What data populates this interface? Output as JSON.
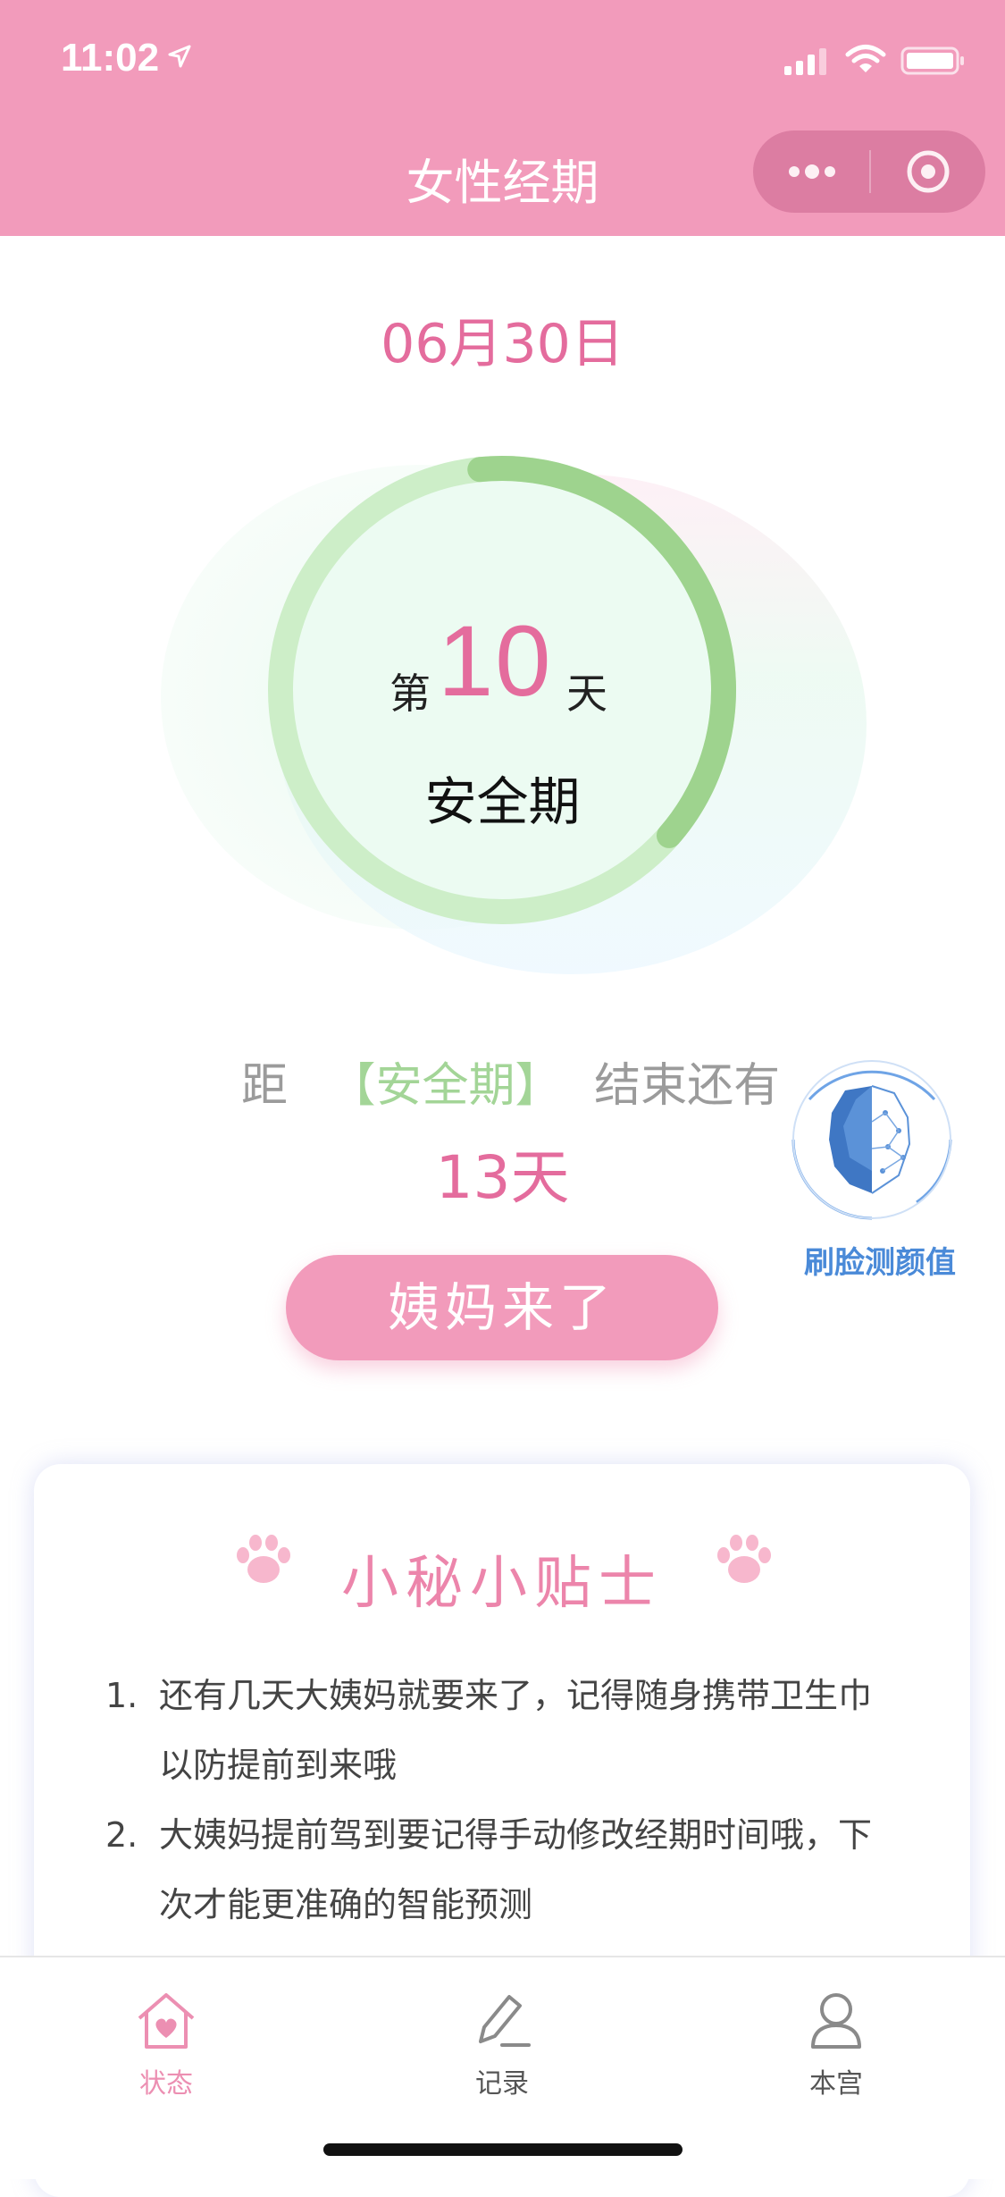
{
  "status_bar": {
    "time": "11:02"
  },
  "nav": {
    "title": "女性经期"
  },
  "date": "06月30日",
  "cycle": {
    "day_prefix": "第",
    "day_number": "10",
    "day_suffix": "天",
    "phase": "安全期",
    "progress_fraction": 0.38
  },
  "countdown": {
    "prefix": "距",
    "phase_tag": "【安全期】",
    "suffix": "结束还有",
    "days": "13天"
  },
  "face_widget": {
    "label": "刷脸测颜值"
  },
  "period_button": {
    "label": "姨妈来了"
  },
  "tips": {
    "title": "小秘小贴士",
    "items": [
      {
        "num": "1.",
        "text": "还有几天大姨妈就要来了，记得随身携带卫生巾以防提前到来哦"
      },
      {
        "num": "2.",
        "text": "大姨妈提前驾到要记得手动修改经期时间哦，下次才能更准确的智能预测"
      }
    ]
  },
  "tabbar": {
    "tabs": [
      {
        "label": "状态",
        "icon": "home-heart-icon"
      },
      {
        "label": "记录",
        "icon": "pen-icon"
      },
      {
        "label": "本宫",
        "icon": "user-icon"
      }
    ]
  },
  "colors": {
    "header": "#f29bbb",
    "accent_pink": "#e46c9d",
    "safe_green": "#a3d597",
    "face_blue": "#4a8ad8"
  }
}
